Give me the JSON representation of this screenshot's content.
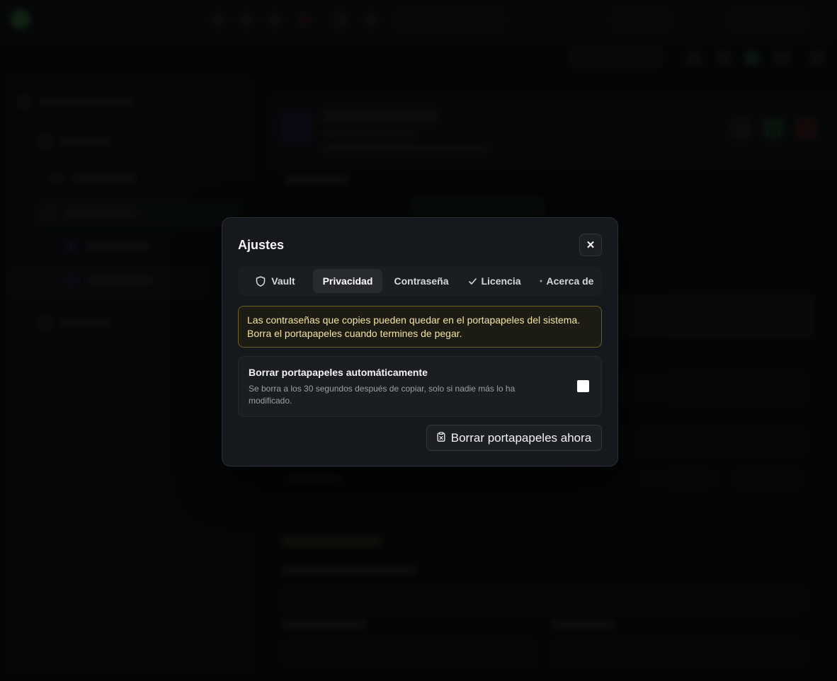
{
  "modal": {
    "title": "Ajustes",
    "close_label": "✕"
  },
  "tabs": [
    {
      "label": "Vault",
      "icon": "shield-icon",
      "active": false
    },
    {
      "label": "Privacidad",
      "icon": "",
      "active": true
    },
    {
      "label": "Contraseña",
      "icon": "",
      "active": false
    },
    {
      "label": "Licencia",
      "icon": "check-icon",
      "active": false
    },
    {
      "label": "Acerca de",
      "icon": "dot-icon",
      "active": false
    }
  ],
  "warning": {
    "line1": "Las contraseñas que copies pueden quedar en el portapapeles del sistema.",
    "line2": "Borra el portapapeles cuando termines de pegar."
  },
  "auto_clear": {
    "title": "Borrar portapapeles automáticamente",
    "description": "Se borra a los 30 segundos después de copiar, solo si nadie más lo ha modificado.",
    "checked": false
  },
  "clear_now_button": {
    "label": "Borrar portapapeles ahora",
    "icon": "clipboard-x-icon"
  },
  "colors": {
    "accent": "#4a9a55",
    "warning_border": "#6b5f26",
    "warning_text": "#f5e3a5"
  }
}
